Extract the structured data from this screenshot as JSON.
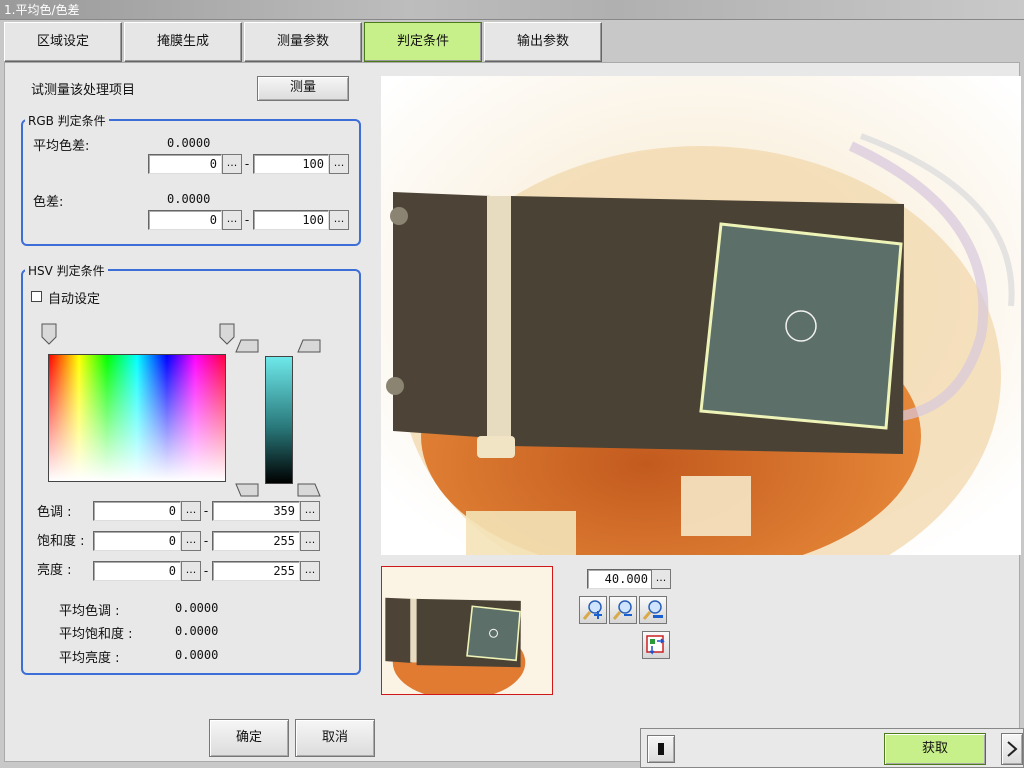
{
  "window": {
    "title": "1.平均色/色差"
  },
  "tabs": [
    {
      "label": "区域设定"
    },
    {
      "label": "掩膜生成"
    },
    {
      "label": "测量参数"
    },
    {
      "label": "判定条件"
    },
    {
      "label": "输出参数"
    }
  ],
  "active_tab": "判定条件",
  "trial": {
    "label": "试测量该处理项目",
    "button": "测量"
  },
  "rgb": {
    "title": "RGB 判定条件",
    "avg_diff": {
      "label": "平均色差:",
      "value": "0.0000",
      "min": "0",
      "max": "100"
    },
    "diff": {
      "label": "色差:",
      "value": "0.0000",
      "min": "0",
      "max": "100"
    }
  },
  "hsv": {
    "title": "HSV 判定条件",
    "auto_label": "自动设定",
    "auto_checked": false,
    "hue": {
      "label": "色调 :",
      "min": "0",
      "max": "359"
    },
    "sat": {
      "label": "饱和度 :",
      "min": "0",
      "max": "255"
    },
    "bri": {
      "label": "亮度 :",
      "min": "0",
      "max": "255"
    },
    "avg_hue": {
      "label": "平均色调 :",
      "value": "0.0000"
    },
    "avg_sat": {
      "label": "平均饱和度 :",
      "value": "0.0000"
    },
    "avg_bri": {
      "label": "平均亮度 :",
      "value": "0.0000"
    }
  },
  "dots": "...",
  "dash": "-",
  "zoom": {
    "value": "40.000"
  },
  "footer": {
    "ok": "确定",
    "cancel": "取消",
    "acquire": "获取"
  },
  "icons": [
    "zoom-in-icon",
    "zoom-out-icon",
    "zoom-fit-icon",
    "image-display-icon",
    "stop-icon",
    "chevron-right-icon",
    "checkbox-icon"
  ]
}
